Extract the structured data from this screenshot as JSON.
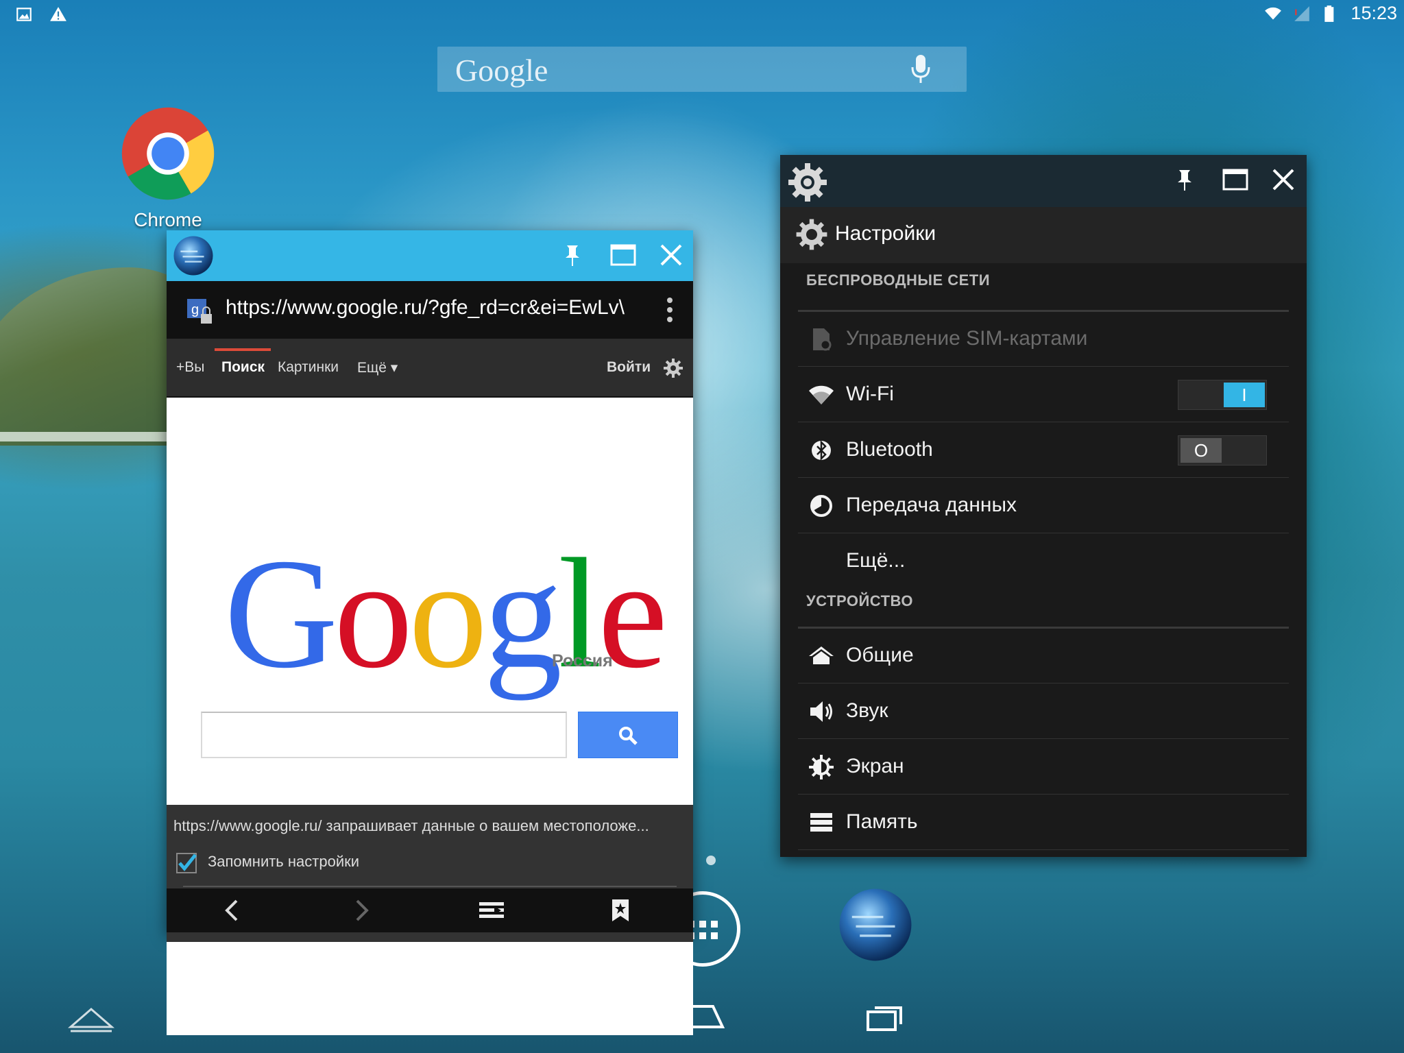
{
  "statusbar": {
    "time": "15:23",
    "icons": [
      "image-icon",
      "warning-icon",
      "wifi-icon",
      "signal-icon",
      "battery-icon"
    ]
  },
  "search_widget": {
    "logo": "Google",
    "mic": "mic-icon"
  },
  "desktop": {
    "chrome_label": "Chrome"
  },
  "browser": {
    "url": "https://www.google.ru/?gfe_rd=cr&ei=EwLv\\",
    "nav": {
      "plus_you": "+Вы",
      "search": "Поиск",
      "images": "Картинки",
      "more": "Ещё ▾",
      "login": "Войти"
    },
    "logo_letters": [
      {
        "ch": "G",
        "color": "#3369e8"
      },
      {
        "ch": "o",
        "color": "#d50f25"
      },
      {
        "ch": "o",
        "color": "#eeb211"
      },
      {
        "ch": "g",
        "color": "#3369e8"
      },
      {
        "ch": "l",
        "color": "#009925"
      },
      {
        "ch": "e",
        "color": "#d50f25"
      }
    ],
    "region": "Россия",
    "search_value": "",
    "geo_message": "https://www.google.ru/ запрашивает данные о вашем местоположе...",
    "remember_label": "Запомнить настройки",
    "remember_checked": true
  },
  "settings": {
    "title": "Настройки",
    "sections": [
      {
        "title": "БЕСПРОВОДНЫЕ СЕТИ",
        "items": [
          {
            "label": "Управление SIM-картами",
            "icon": "sim-icon",
            "disabled": true
          },
          {
            "label": "Wi-Fi",
            "icon": "wifi-icon",
            "toggle": "on"
          },
          {
            "label": "Bluetooth",
            "icon": "bluetooth-icon",
            "toggle": "off"
          },
          {
            "label": "Передача данных",
            "icon": "data-usage-icon"
          },
          {
            "label": "Ещё...",
            "icon": ""
          }
        ]
      },
      {
        "title": "УСТРОЙСТВО",
        "items": [
          {
            "label": "Общие",
            "icon": "home-icon"
          },
          {
            "label": "Звук",
            "icon": "volume-icon"
          },
          {
            "label": "Экран",
            "icon": "brightness-icon"
          },
          {
            "label": "Память",
            "icon": "storage-icon"
          }
        ]
      }
    ],
    "toggle_on_glyph": "I",
    "toggle_off_glyph": "O"
  },
  "colors": {
    "browser_titlebar": "#35b6e6",
    "settings_titlebar": "#1b2a33",
    "toggle_on": "#33b5e5",
    "google_search_btn": "#4a8af4"
  }
}
